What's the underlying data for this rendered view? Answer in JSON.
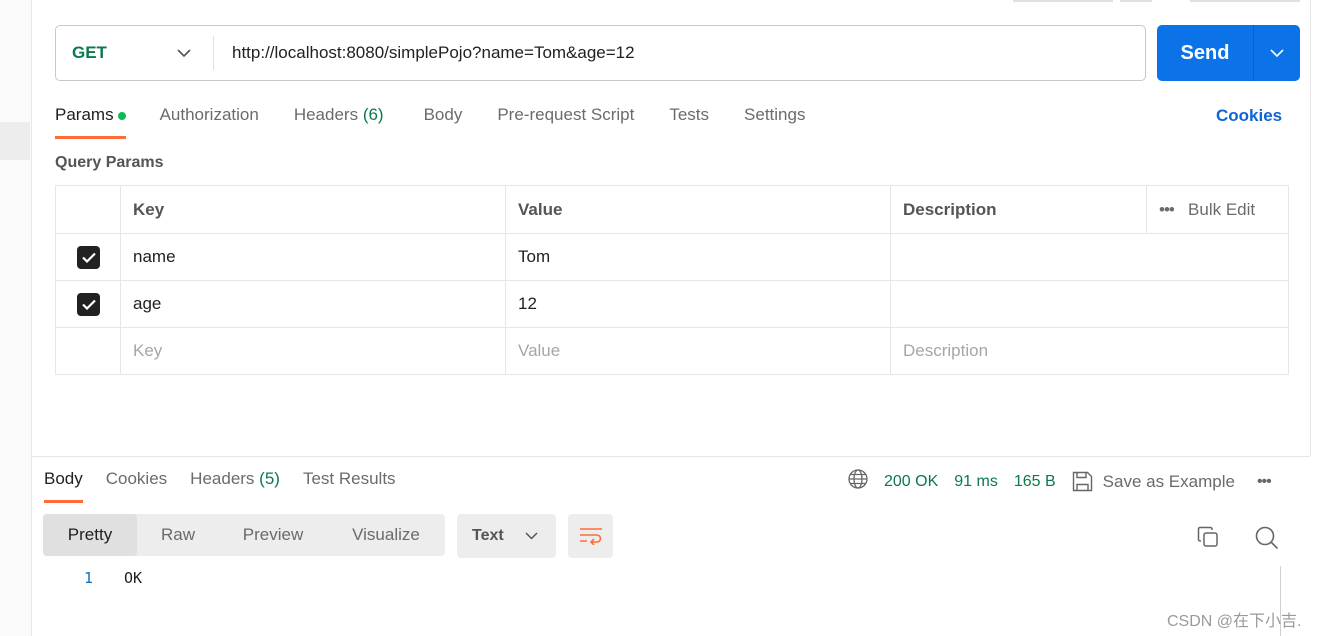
{
  "request": {
    "method": "GET",
    "url": "http://localhost:8080/simplePojo?name=Tom&age=12",
    "send_label": "Send"
  },
  "tabs": [
    {
      "label": "Params"
    },
    {
      "label": "Authorization"
    },
    {
      "label": "Headers",
      "count": "(6)"
    },
    {
      "label": "Body"
    },
    {
      "label": "Pre-request Script"
    },
    {
      "label": "Tests"
    },
    {
      "label": "Settings"
    }
  ],
  "cookies_label": "Cookies",
  "query_params": {
    "title": "Query Params",
    "headers": [
      "Key",
      "Value",
      "Description"
    ],
    "bulk_edit": "Bulk Edit",
    "rows": [
      {
        "checked": true,
        "key": "name",
        "value": "Tom",
        "description": ""
      },
      {
        "checked": true,
        "key": "age",
        "value": "12",
        "description": ""
      }
    ],
    "placeholder": {
      "key": "Key",
      "value": "Value",
      "description": "Description"
    }
  },
  "response": {
    "tabs": [
      {
        "label": "Body"
      },
      {
        "label": "Cookies"
      },
      {
        "label": "Headers",
        "count": "(5)"
      },
      {
        "label": "Test Results"
      }
    ],
    "status": "200 OK",
    "time": "91 ms",
    "size": "165 B",
    "save_example": "Save as Example",
    "views": [
      "Pretty",
      "Raw",
      "Preview",
      "Visualize"
    ],
    "format": "Text",
    "lines": [
      {
        "num": "1",
        "text": "OK"
      }
    ]
  },
  "watermark": "CSDN @在下小吉.",
  "colors": {
    "accent": "#ff6c37",
    "send": "#0c72e8",
    "success": "#0b7a4b"
  }
}
